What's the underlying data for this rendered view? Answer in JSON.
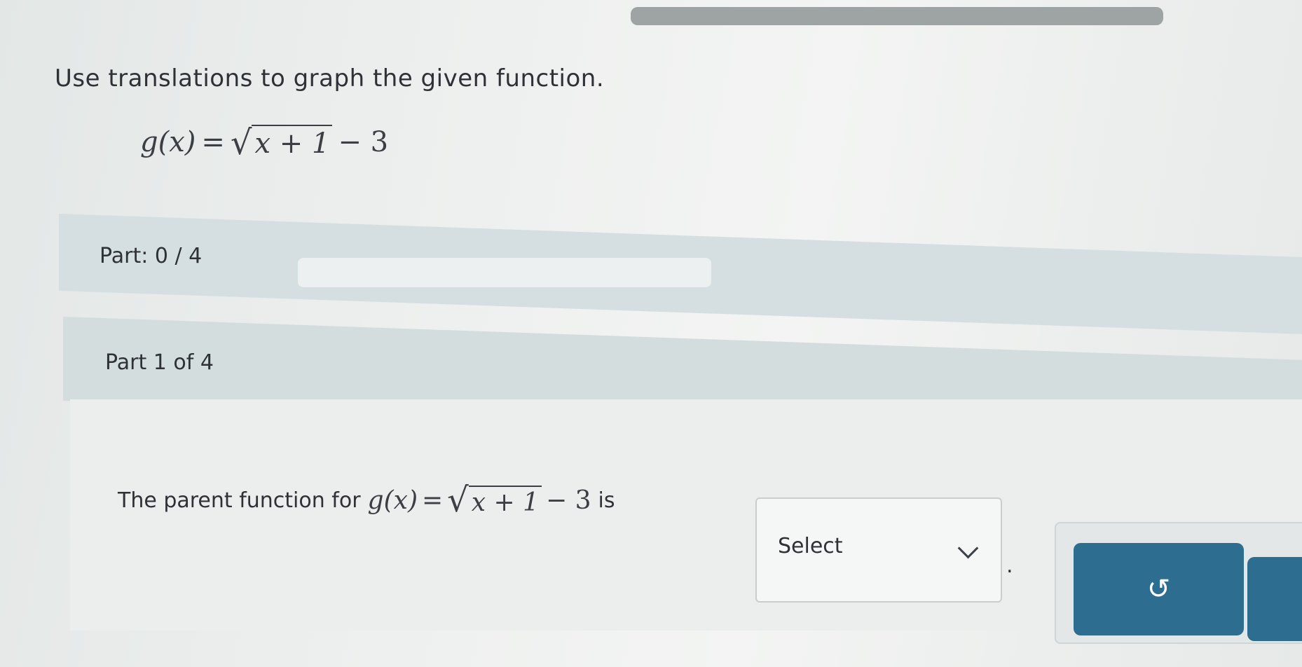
{
  "instruction": "Use translations to graph the given function.",
  "equation": {
    "lhs": "g(x)",
    "equals": "=",
    "radicand": "x + 1",
    "tail": "− 3"
  },
  "progress": {
    "label": "Part: 0 / 4",
    "value": 0,
    "total": 4,
    "fill_fraction": 0
  },
  "part": {
    "title": "Part 1 of 4"
  },
  "question": {
    "prefix": "The parent function for",
    "lhs": "g(x)",
    "equals": "=",
    "radicand": "x + 1",
    "tail": "− 3",
    "suffix": "is",
    "period": "."
  },
  "select": {
    "label": "Select"
  },
  "buttons": {
    "undo_icon": "undo-icon"
  },
  "colors": {
    "accent": "#2d6e90",
    "band": "#d3ddde"
  }
}
